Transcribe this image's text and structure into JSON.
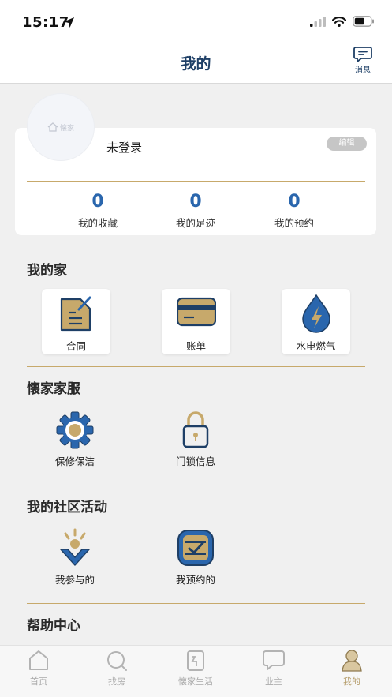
{
  "status_bar": {
    "time": "15:17"
  },
  "nav": {
    "title": "我的",
    "message_label": "消息"
  },
  "profile": {
    "avatar_logo_text": "懐家",
    "login_status": "未登录",
    "edit_label": "编辑",
    "stats": [
      {
        "value": "0",
        "label": "我的收藏"
      },
      {
        "value": "0",
        "label": "我的足迹"
      },
      {
        "value": "0",
        "label": "我的预约"
      }
    ]
  },
  "my_home": {
    "title": "我的家",
    "items": [
      {
        "label": "合同",
        "icon": "contract-icon"
      },
      {
        "label": "账单",
        "icon": "bill-card-icon"
      },
      {
        "label": "水电燃气",
        "icon": "utility-drop-icon"
      }
    ]
  },
  "home_service": {
    "title": "懐家家服",
    "items": [
      {
        "label": "保修保洁",
        "icon": "gear-icon"
      },
      {
        "label": "门锁信息",
        "icon": "lock-icon"
      }
    ]
  },
  "community": {
    "title": "我的社区活动",
    "items": [
      {
        "label": "我参与的",
        "icon": "participate-icon"
      },
      {
        "label": "我预约的",
        "icon": "calendar-check-icon"
      }
    ]
  },
  "help": {
    "title": "帮助中心"
  },
  "tab_bar": {
    "items": [
      {
        "label": "首页",
        "icon": "home-icon"
      },
      {
        "label": "找房",
        "icon": "search-icon"
      },
      {
        "label": "懐家生活",
        "icon": "life-icon"
      },
      {
        "label": "业主",
        "icon": "chat-bubble-icon"
      },
      {
        "label": "我的",
        "icon": "user-icon"
      }
    ],
    "active_index": 4
  },
  "colors": {
    "brand_blue": "#2a66ad",
    "gold": "#c7a96b",
    "title_blue": "#1e3f66",
    "tab_inactive": "#a9a9a9",
    "tab_active": "#b39a66"
  }
}
